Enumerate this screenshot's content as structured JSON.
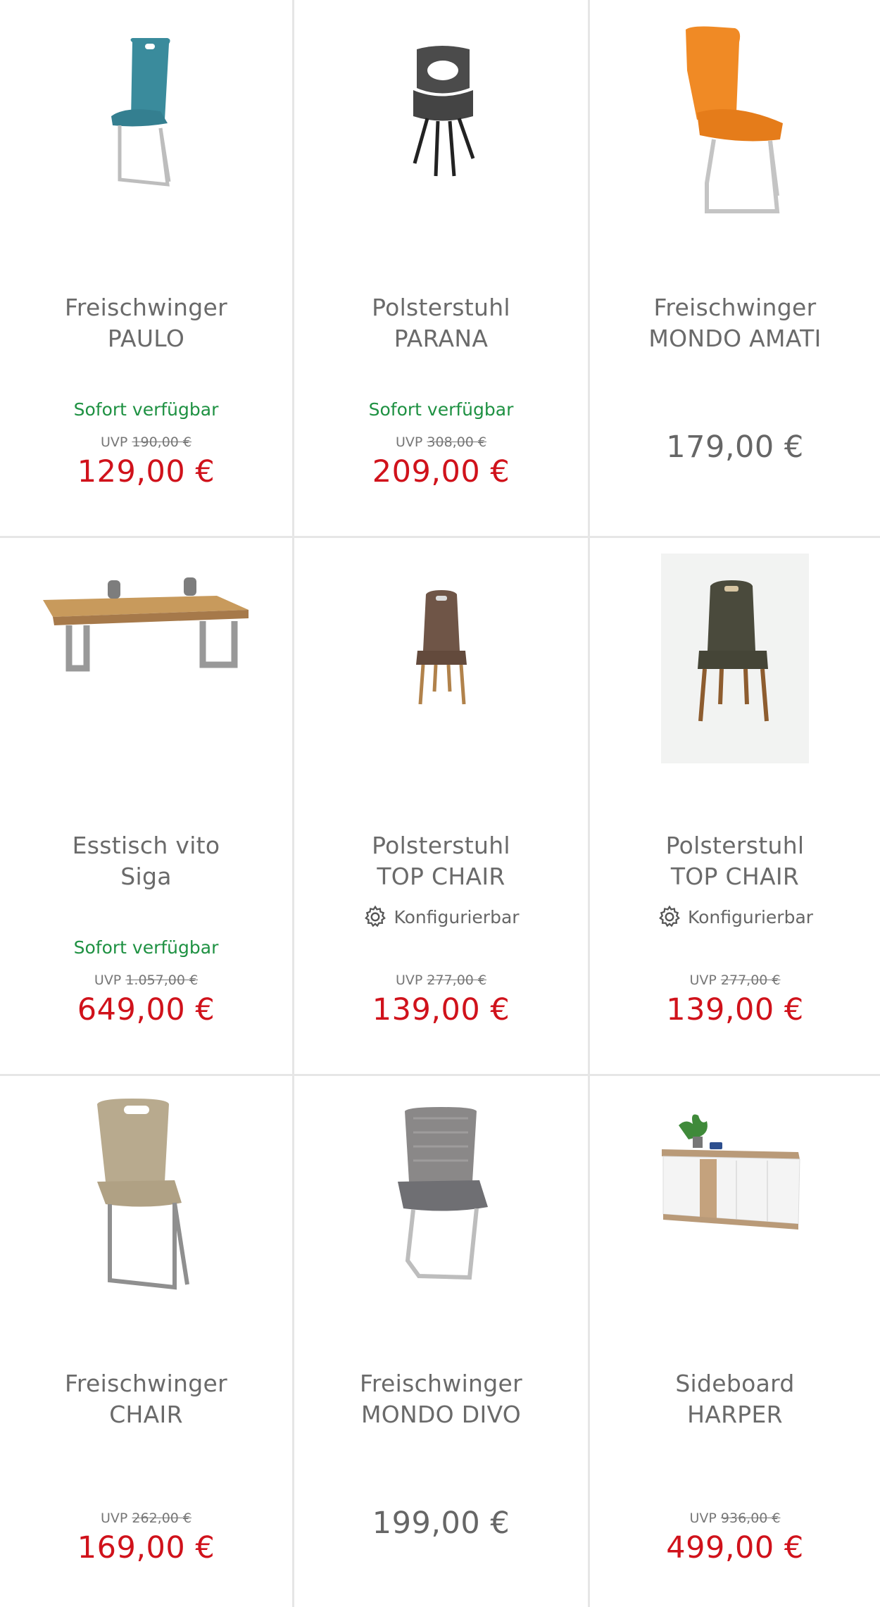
{
  "products": [
    {
      "line1": "Freischwinger",
      "line2": "PAULO",
      "availability": "Sofort verfügbar",
      "uvp_label": "UVP",
      "uvp_price": "190,00 €",
      "price": "129,00 €",
      "image_icon": "chair-teal-cantilever"
    },
    {
      "line1": "Polsterstuhl",
      "line2": "PARANA",
      "availability": "Sofort verfügbar",
      "uvp_label": "UVP",
      "uvp_price": "308,00 €",
      "price": "209,00 €",
      "image_icon": "chair-grey-armchair"
    },
    {
      "line1": "Freischwinger",
      "line2": "MONDO AMATI",
      "price": "179,00 €",
      "image_icon": "chair-orange-cantilever"
    },
    {
      "line1": "Esstisch vito",
      "line2": "Siga",
      "availability": "Sofort verfügbar",
      "uvp_label": "UVP",
      "uvp_price": "1.057,00 €",
      "price": "649,00 €",
      "image_icon": "dining-table-oak"
    },
    {
      "line1": "Polsterstuhl",
      "line2": "TOP CHAIR",
      "config": "Konfigurierbar",
      "uvp_label": "UVP",
      "uvp_price": "277,00 €",
      "price": "139,00 €",
      "image_icon": "chair-brown-wood-legs"
    },
    {
      "line1": "Polsterstuhl",
      "line2": "TOP CHAIR",
      "config": "Konfigurierbar",
      "uvp_label": "UVP",
      "uvp_price": "277,00 €",
      "price": "139,00 €",
      "image_icon": "chair-anthracite-wood-legs"
    },
    {
      "line1": "Freischwinger",
      "line2": "CHAIR",
      "uvp_label": "UVP",
      "uvp_price": "262,00 €",
      "price": "169,00 €",
      "image_icon": "chair-beige-cantilever"
    },
    {
      "line1": "Freischwinger",
      "line2": "MONDO DIVO",
      "price": "199,00 €",
      "image_icon": "chair-grey-mesh-cantilever"
    },
    {
      "line1": "Sideboard",
      "line2": "HARPER",
      "uvp_label": "UVP",
      "uvp_price": "936,00 €",
      "price": "499,00 €",
      "image_icon": "sideboard-white-oak"
    }
  ],
  "colors": {
    "availability": "#1e9142",
    "sale_price": "#d0121b",
    "regular_price": "#666666",
    "border": "#e6e6e6"
  }
}
